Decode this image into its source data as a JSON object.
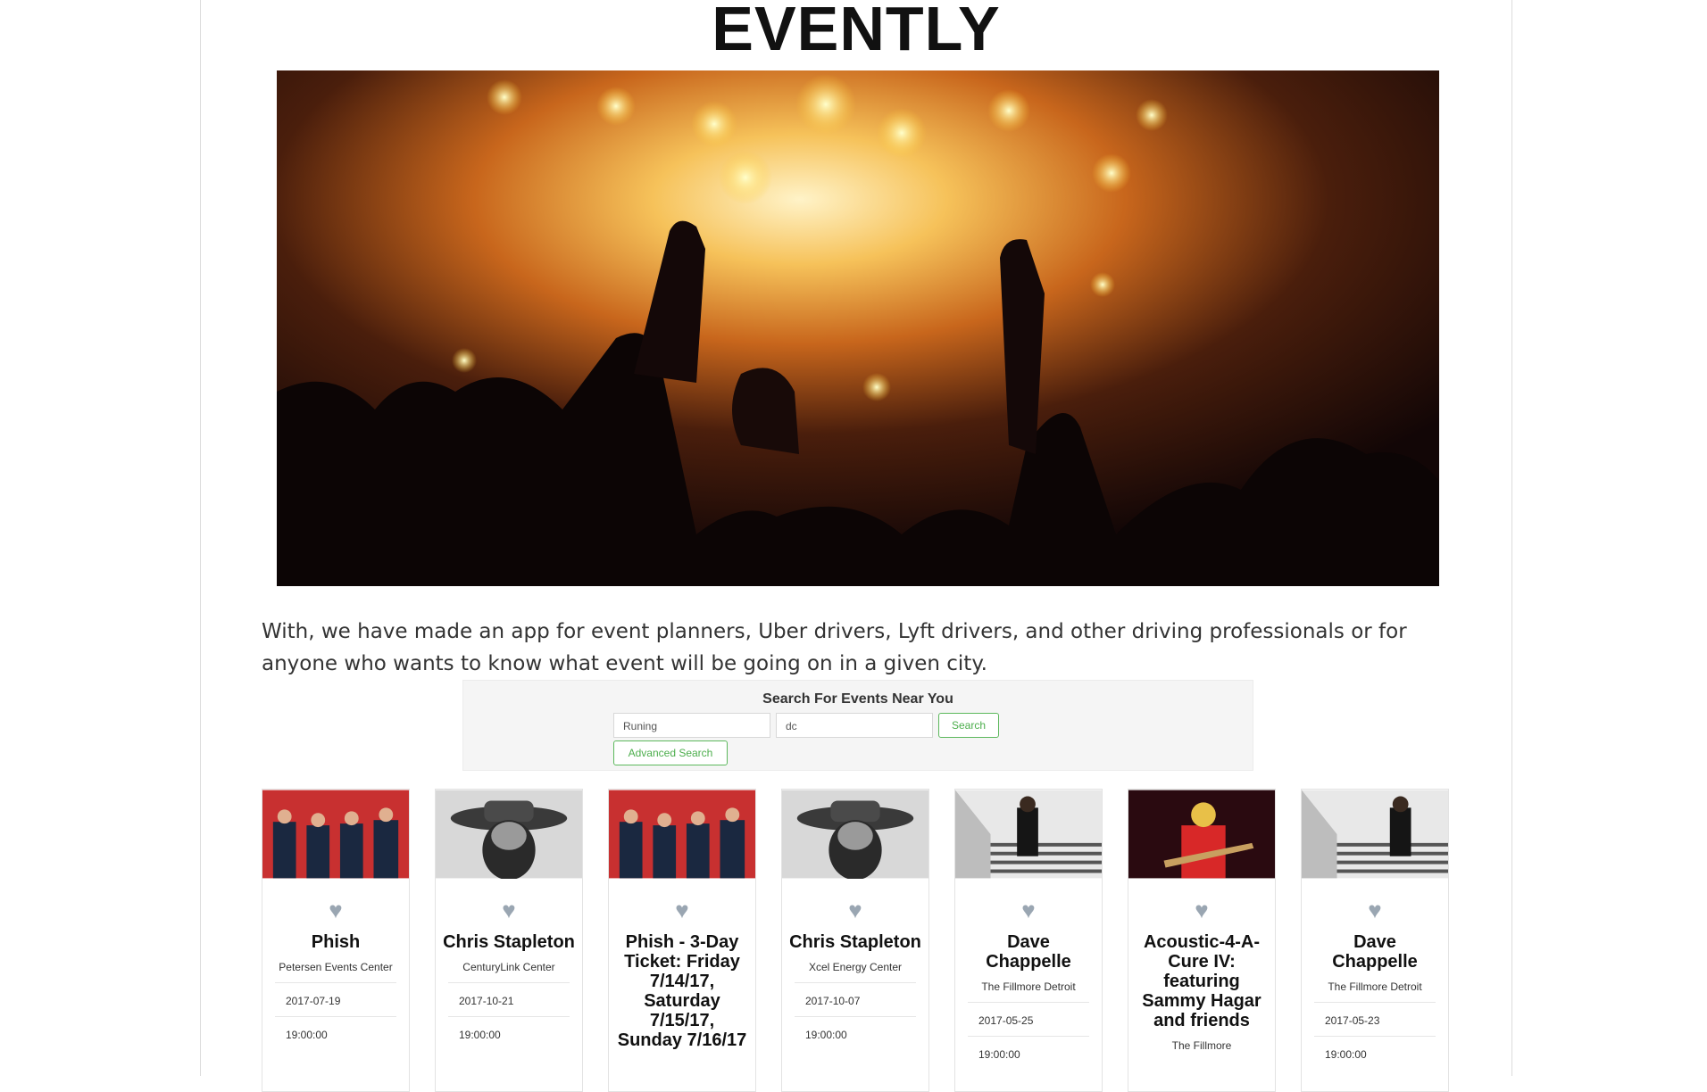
{
  "app": {
    "title": "EVENTLY"
  },
  "intro": "With, we have made an app for event planners, Uber drivers, Lyft drivers, and other driving professionals or for anyone who wants to know what event will be going on in a given city.",
  "search": {
    "title": "Search For Events Near You",
    "keyword_value": "Runing",
    "location_value": "dc",
    "search_label": "Search",
    "advanced_label": "Advanced Search"
  },
  "colors": {
    "accent_green": "#5cb85c",
    "heart": "#9aa6b2"
  },
  "events": [
    {
      "title": "Phish",
      "venue": "Petersen Events Center",
      "date": "2017-07-19",
      "time": "19:00:00",
      "image": "band-photo"
    },
    {
      "title": "Chris Stapleton",
      "venue": "CenturyLink Center",
      "date": "2017-10-21",
      "time": "19:00:00",
      "image": "portrait-photo"
    },
    {
      "title": "Phish - 3-Day Ticket: Friday 7/14/17, Saturday 7/15/17, Sunday 7/16/17",
      "venue": "",
      "date": "",
      "time": "",
      "image": "band-photo"
    },
    {
      "title": "Chris Stapleton",
      "venue": "Xcel Energy Center",
      "date": "2017-10-07",
      "time": "19:00:00",
      "image": "portrait-photo"
    },
    {
      "title": "Dave Chappelle",
      "venue": "The Fillmore Detroit",
      "date": "2017-05-25",
      "time": "19:00:00",
      "image": "stairs-photo"
    },
    {
      "title": "Acoustic-4-A-Cure IV: featuring Sammy Hagar and friends",
      "venue": "The Fillmore",
      "date": "",
      "time": "",
      "image": "guitarist-photo"
    },
    {
      "title": "Dave Chappelle",
      "venue": "The Fillmore Detroit",
      "date": "2017-05-23",
      "time": "19:00:00",
      "image": "stairs-photo"
    }
  ]
}
